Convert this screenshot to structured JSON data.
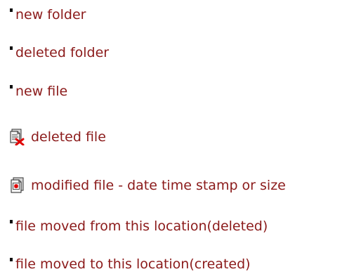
{
  "legend": {
    "items": [
      {
        "label": "new folder",
        "icon": "bullet"
      },
      {
        "label": "deleted folder",
        "icon": "bullet"
      },
      {
        "label": "new file",
        "icon": "bullet"
      },
      {
        "label": "deleted file",
        "icon": "deleted-file-icon"
      },
      {
        "label": "modified file - date time stamp or size",
        "icon": "modified-file-icon"
      },
      {
        "label": "file moved from this location(deleted)",
        "icon": "bullet"
      },
      {
        "label": "file moved to this location(created)",
        "icon": "bullet"
      }
    ]
  },
  "colors": {
    "label_text": "#8b1a1a",
    "bullet": "#111111",
    "delete_mark": "#e00000"
  }
}
